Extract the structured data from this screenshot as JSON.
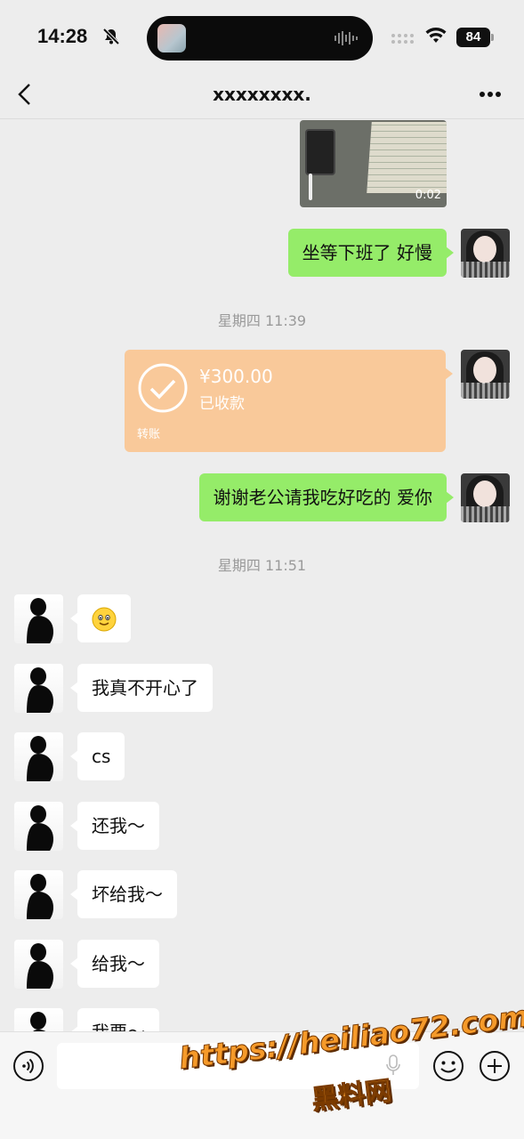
{
  "status_bar": {
    "time": "14:28",
    "battery": "84",
    "icons": [
      "bell-slash-icon",
      "cellular-icon",
      "wifi-icon",
      "battery-icon"
    ]
  },
  "header": {
    "title": "xxxxxxxx.",
    "back_icon": "chevron-left-icon",
    "more_icon": "more-dots-icon"
  },
  "video": {
    "duration": "0:02"
  },
  "messages_a": {
    "m1": "坐等下班了 好慢"
  },
  "timestamp_1": "星期四 11:39",
  "transfer": {
    "amount": "¥300.00",
    "status": "已收款",
    "label": "转账"
  },
  "messages_b": {
    "m2": "谢谢老公请我吃好吃的 爱你"
  },
  "timestamp_2": "星期四 11:51",
  "incoming": {
    "m3": "我真不开心了",
    "m4": "cs",
    "m5": "还我～",
    "m6": "坏给我～",
    "m7": "给我～",
    "m8": "我要～"
  },
  "input_bar": {
    "text": "",
    "icons": [
      "voice-icon",
      "emoji-icon",
      "plus-icon"
    ]
  },
  "watermark": {
    "url": "https://heiliao72.com",
    "name": "黑料网"
  },
  "colors": {
    "self_bubble": "#95ec69",
    "other_bubble": "#ffffff",
    "transfer": "#f9c99a",
    "background": "#ededed"
  }
}
